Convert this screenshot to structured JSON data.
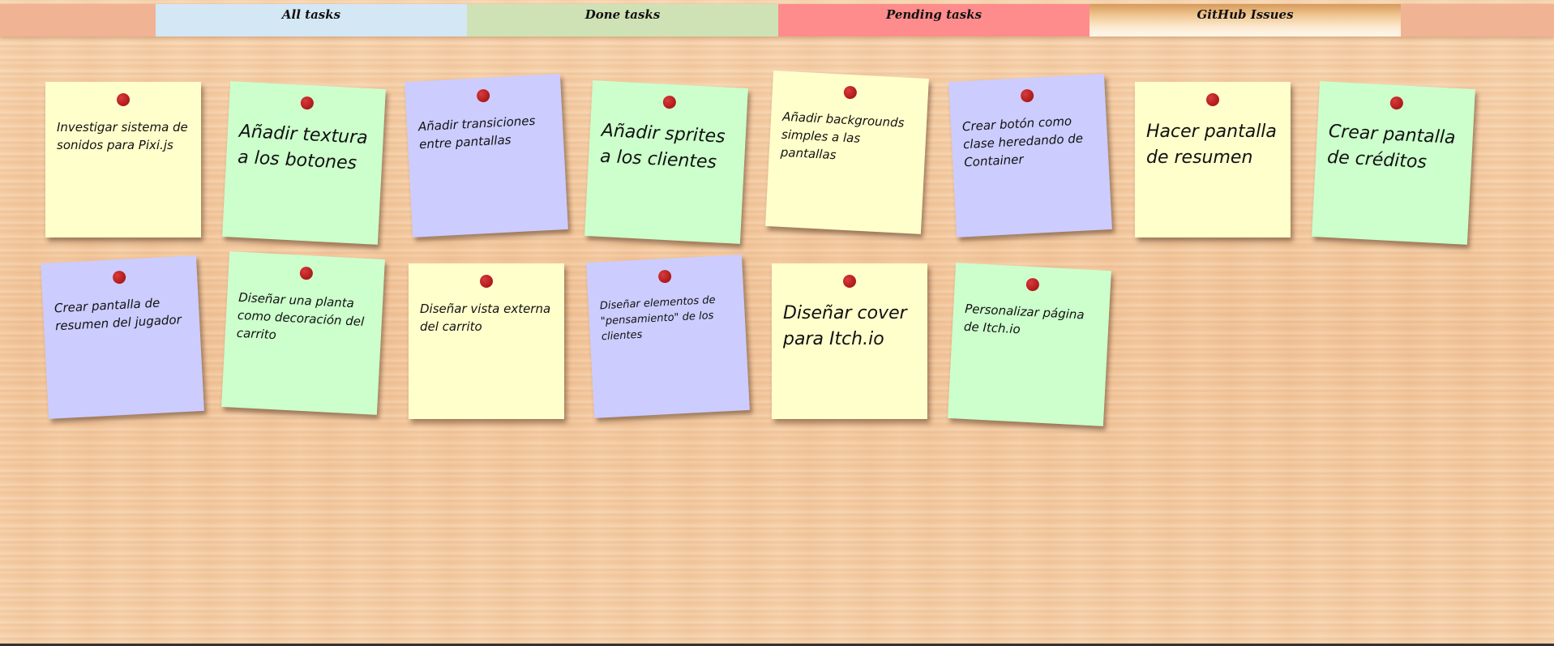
{
  "tabs": {
    "all": "All tasks",
    "done": "Done tasks",
    "pending": "Pending tasks",
    "github": "GitHub Issues"
  },
  "colors": {
    "yellow_note": "#ffffcc",
    "green_note": "#ccffcc",
    "blue_note": "#ccccff",
    "pin": "#b51d1d",
    "tab_all": "#d4e7f5",
    "tab_done": "#cfe2b5",
    "tab_pending": "#ff8c8c"
  },
  "notes": [
    {
      "color": "yellow",
      "text": "Investigar sistema de sonidos para Pixi.js"
    },
    {
      "color": "green",
      "text": "Añadir textura a los botones"
    },
    {
      "color": "blue",
      "text": "Añadir transiciones entre pantallas"
    },
    {
      "color": "green",
      "text": "Añadir sprites a los clientes"
    },
    {
      "color": "yellow",
      "text": "Añadir backgrounds simples a las pantallas"
    },
    {
      "color": "blue",
      "text": "Crear botón como clase heredando de Container"
    },
    {
      "color": "yellow",
      "text": "Hacer pantalla de resumen"
    },
    {
      "color": "green",
      "text": "Crear pantalla de créditos"
    },
    {
      "color": "blue",
      "text": "Crear pantalla de resumen del jugador"
    },
    {
      "color": "green",
      "text": "Diseñar una planta como decoración del carrito"
    },
    {
      "color": "yellow",
      "text": "Diseñar vista externa del carrito"
    },
    {
      "color": "blue",
      "text": "Diseñar elementos de \"pensamiento\" de los clientes"
    },
    {
      "color": "yellow",
      "text": "Diseñar cover para Itch.io"
    },
    {
      "color": "green",
      "text": "Personalizar página de Itch.io"
    }
  ]
}
